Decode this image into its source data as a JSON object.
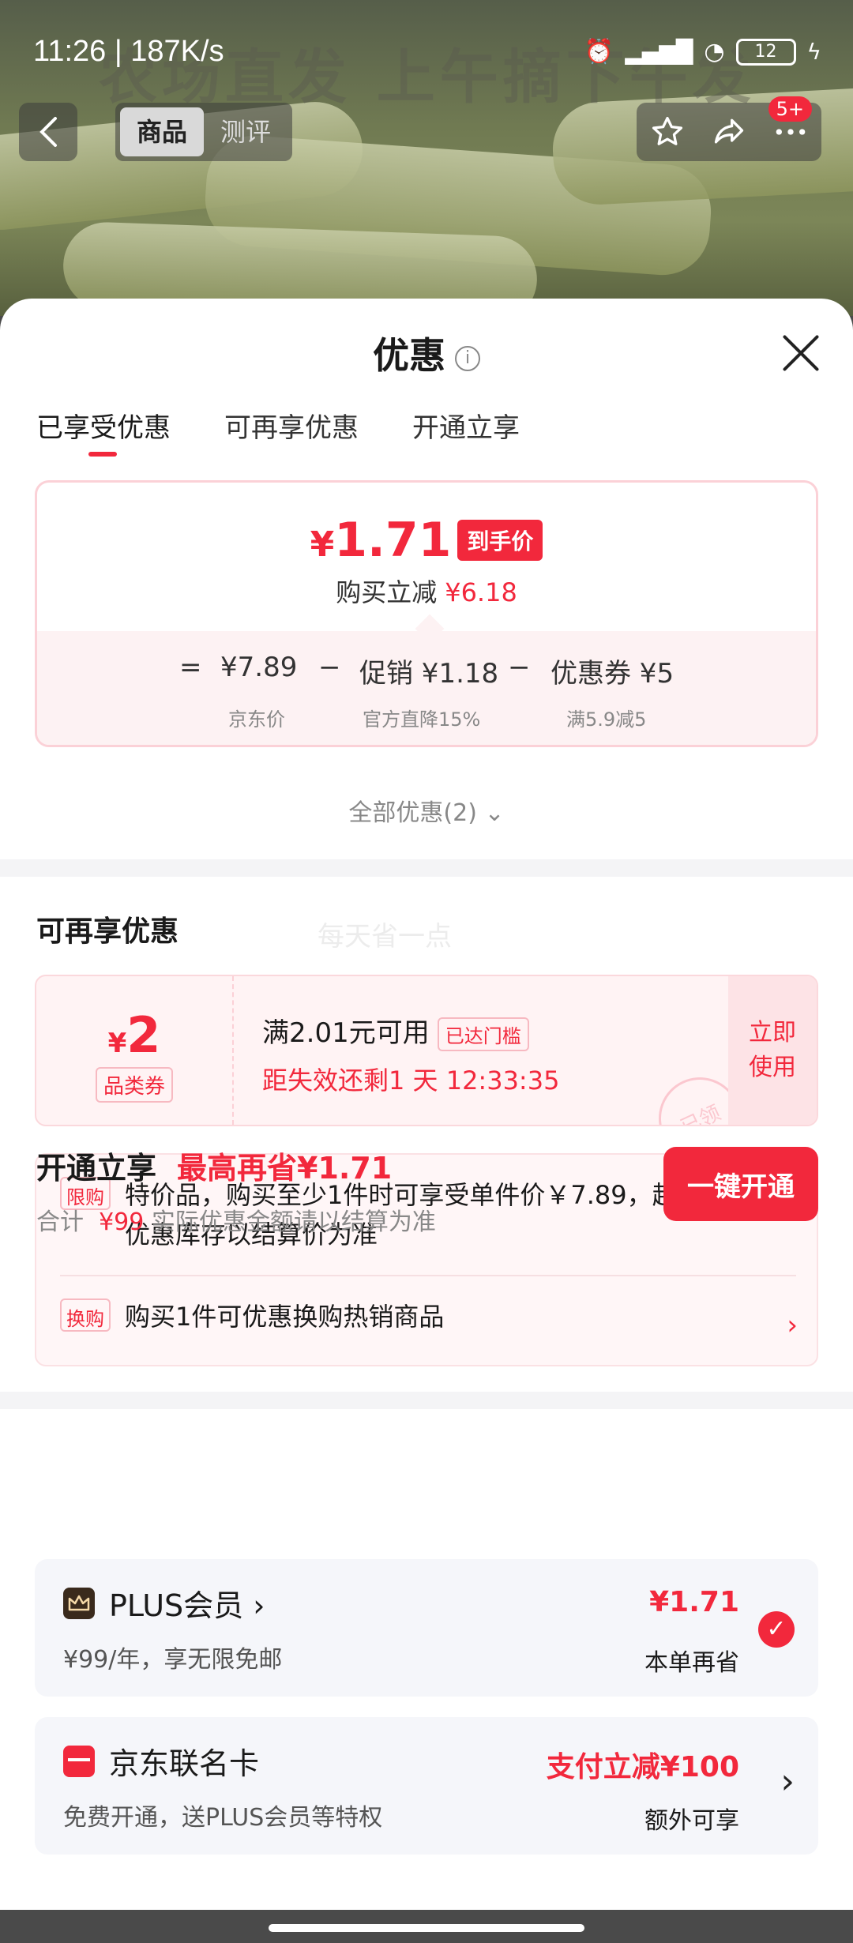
{
  "status": {
    "time": "11:26 | 187K/s",
    "battery": "12"
  },
  "hero": {
    "banner": "农场直发 上午摘下午发"
  },
  "topbar": {
    "tabs": [
      "商品",
      "测评"
    ],
    "badge": "5+"
  },
  "sheet": {
    "title": "优惠",
    "tabs": [
      "已享受优惠",
      "可再享优惠",
      "开通立享"
    ]
  },
  "price_card": {
    "currency": "¥",
    "price": "1.71",
    "final_tag": "到手价",
    "saving_label": "购买立减",
    "saving_value": "¥6.18",
    "formula": {
      "eq": "=",
      "base": "¥7.89",
      "base_note": "京东价",
      "minus1": "−",
      "promo": "促销 ¥1.18",
      "promo_note": "官方直降15%",
      "minus2": "−",
      "coupon": "优惠券 ¥5",
      "coupon_note": "满5.9减5"
    }
  },
  "all_discounts": "全部优惠(2)",
  "more": {
    "title": "可再享优惠",
    "watermark": "每天省一点",
    "coupon": {
      "currency": "¥",
      "amount": "2",
      "type": "品类券",
      "condition": "满2.01元可用",
      "reached": "已达门槛",
      "timer": "距失效还剩1 天 12:33:35",
      "use_label": "立即使用",
      "stamp": "已领"
    },
    "rules": [
      {
        "tag": "限购",
        "text": "特价品，购买至少1件时可享受单件价￥7.89，超出数量或优惠库存以结算价为准"
      },
      {
        "tag": "换购",
        "text": "购买1件可优惠换购热销商品"
      }
    ]
  },
  "plus": {
    "title": "开通立享",
    "max_save": "最高再省¥1.71",
    "total_label": "合计",
    "total_value": "¥99",
    "total_note": "实际优惠金额请以结算为准",
    "open_label": "一键开通",
    "cards": [
      {
        "name": "PLUS会员 ›",
        "desc": "¥99/年，享无限免邮",
        "value": "¥1.71",
        "value2": "本单再省"
      },
      {
        "name": "京东联名卡",
        "desc": "免费开通，送PLUS会员等特权",
        "value": "支付立减¥100",
        "value2": "额外可享"
      }
    ]
  }
}
